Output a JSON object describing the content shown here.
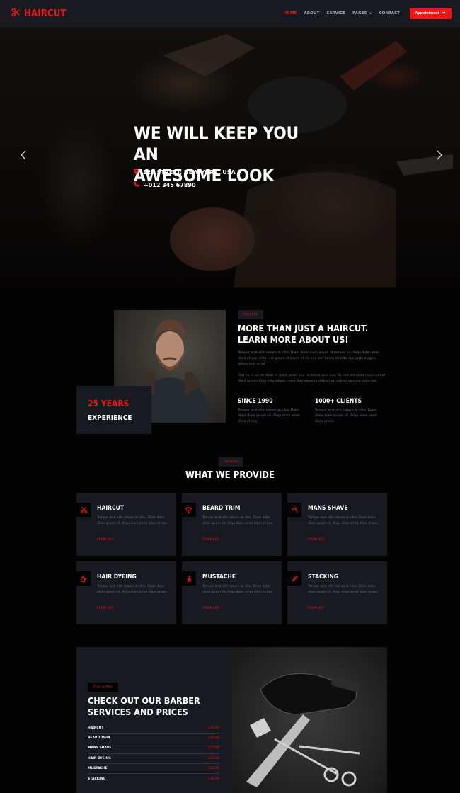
{
  "nav": {
    "brand": "HAIRCUT",
    "items": [
      {
        "label": "HOME",
        "active": true
      },
      {
        "label": "ABOUT",
        "active": false
      },
      {
        "label": "SERVICE",
        "active": false
      },
      {
        "label": "PAGES",
        "active": false,
        "dropdown": true
      },
      {
        "label": "CONTACT",
        "active": false
      }
    ],
    "cta": "Appointment",
    "icons": {
      "brand": "scissors-icon",
      "cta": "arrow-right-icon",
      "dropdown": "chevron-down-icon"
    }
  },
  "hero": {
    "title_line1": "WE WILL KEEP YOU AN",
    "title_line2": "AWESOME LOOK",
    "address": "123 STREET, NEW YORK, USA",
    "phone": "+012 345 67890",
    "icons": {
      "address": "map-marker-icon",
      "phone": "phone-icon",
      "prev": "chevron-left-icon",
      "next": "chevron-right-icon"
    }
  },
  "about": {
    "tag": "About Us",
    "title": "MORE THAN JUST A HAIRCUT. LEARN MORE ABOUT US!",
    "para1": "Tempor erat elitr rebum at clita. Diam dolor diam ipsum et tempor sit. Aliqu diam amet diam et eos. Clita erat ipsum et lorem et sit, sed stet lorem sit clita duo justo magna dolore erat amet",
    "para2": "Stet no et lorem dolor et diam, amet duo ut dolore vero eos. No stet est diam rebum amet diam ipsum. Clita clita labore, dolor duo nonumy clita sit at, sed sit sanctus dolor eos.",
    "experience_years": "25 YEARS",
    "experience_label": "EXPERIENCE",
    "stats": [
      {
        "title": "SINCE 1990",
        "text": "Tempor erat elitr rebum at clita. Diam dolor diam ipsum sit. Aliqu diam amet diam et eos."
      },
      {
        "title": "1000+ CLIENTS",
        "text": "Tempor erat elitr rebum at clita. Diam dolor diam ipsum sit. Aliqu diam amet diam et eos."
      }
    ]
  },
  "services": {
    "tag": "Services",
    "title": "WHAT WE PROVIDE",
    "items": [
      {
        "name": "HAIRCUT",
        "desc": "Tempor erat elitr rebum at clita. Diam dolor diam ipsum sit. Aliqu diam amet diam et eos.",
        "price": "FROM $15",
        "icon": "haircut-icon"
      },
      {
        "name": "BEARD TRIM",
        "desc": "Tempor erat elitr rebum at clita. Diam dolor diam ipsum sit. Aliqu diam amet diam et eos.",
        "price": "FROM $15",
        "icon": "beard-trim-icon"
      },
      {
        "name": "MANS SHAVE",
        "desc": "Tempor erat elitr rebum at clita. Diam dolor diam ipsum sit. Aliqu diam amet diam et eos.",
        "price": "FROM $15",
        "icon": "razor-icon"
      },
      {
        "name": "HAIR DYEING",
        "desc": "Tempor erat elitr rebum at clita. Diam dolor diam ipsum sit. Aliqu diam amet diam et eos.",
        "price": "FROM $15",
        "icon": "hair-dye-icon"
      },
      {
        "name": "MUSTACHE",
        "desc": "Tempor erat elitr rebum at clita. Diam dolor diam ipsum sit. Aliqu diam amet diam et eos.",
        "price": "FROM $15",
        "icon": "mustache-icon"
      },
      {
        "name": "STACKING",
        "desc": "Tempor erat elitr rebum at clita. Diam dolor diam ipsum sit. Aliqu diam amet diam et eos.",
        "price": "FROM $15",
        "icon": "stacking-icon"
      }
    ]
  },
  "pricing": {
    "tag": "Price & Plan",
    "title": "CHECK OUT OUR BARBER SERVICES AND PRICES",
    "items": [
      {
        "name": "HAIRCUT",
        "price": "$29.00"
      },
      {
        "name": "BEARD TRIM",
        "price": "$35.00"
      },
      {
        "name": "MANS SHAVE",
        "price": "$23.00"
      },
      {
        "name": "HAIR DYEING",
        "price": "$19.00"
      },
      {
        "name": "MUSTACHE",
        "price": "$15.00"
      },
      {
        "name": "STACKING",
        "price": "$39.00"
      }
    ]
  },
  "colors": {
    "accent": "#eb1616",
    "dark": "#030303",
    "panel": "#191922",
    "muted": "#6c6d77"
  }
}
